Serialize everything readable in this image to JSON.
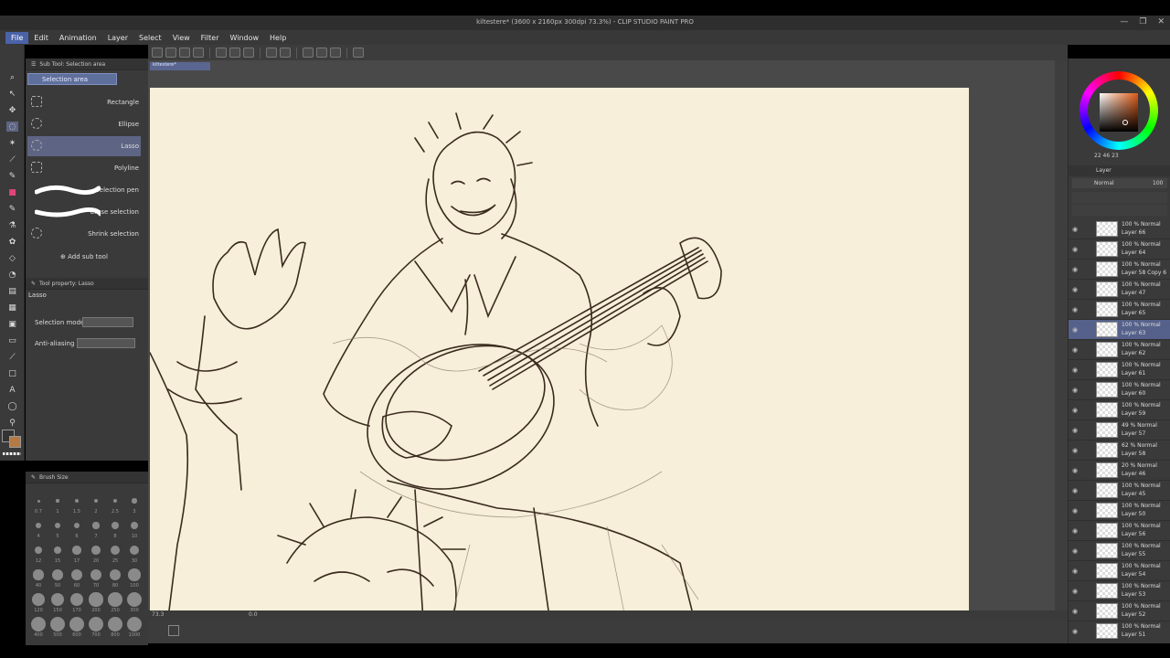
{
  "window": {
    "title": "kiltestere* (3600 x 2160px 300dpi 73.3%) - CLIP STUDIO PAINT PRO",
    "controls": [
      "—",
      "❐",
      "✕"
    ]
  },
  "menu": [
    "File",
    "Edit",
    "Animation",
    "Layer",
    "Select",
    "View",
    "Filter",
    "Window",
    "Help"
  ],
  "subtool_panel": {
    "header": "Sub Tool: Selection area",
    "tab": "Selection area",
    "items": [
      "Rectangle",
      "Ellipse",
      "Lasso",
      "Polyline",
      "Selection pen",
      "Erase selection",
      "Shrink selection"
    ],
    "selected_index": 2,
    "add_label": "Add sub tool"
  },
  "tool_property": {
    "header": "Tool property: Lasso",
    "tool_name": "Lasso",
    "rows": [
      {
        "label": "Selection mode"
      },
      {
        "label": "Anti-aliasing"
      }
    ]
  },
  "brush_size": {
    "header": "Brush Size",
    "labels": [
      "0.7",
      "1",
      "1.5",
      "2",
      "2.5",
      "3",
      "4",
      "5",
      "6",
      "7",
      "8",
      "10",
      "12",
      "15",
      "17",
      "20",
      "25",
      "30",
      "40",
      "50",
      "60",
      "70",
      "80",
      "100",
      "120",
      "150",
      "170",
      "200",
      "250",
      "300",
      "400",
      "500",
      "600",
      "700",
      "800",
      "1000"
    ]
  },
  "canvas": {
    "doc_tab": "kiltestere*",
    "zoom": "73.3",
    "rotation": "0.0"
  },
  "colors": {
    "paper": "#f7efd9",
    "accent": "#4a63a8",
    "sketch": "#3a2a1e"
  },
  "color_wheel": {
    "values": "22  46  23"
  },
  "layer_panel": {
    "header": "Layer",
    "blend": "Normal",
    "opacity": "100",
    "layers": [
      {
        "mode": "100 % Normal",
        "name": "Layer 66"
      },
      {
        "mode": "100 % Normal",
        "name": "Layer 64"
      },
      {
        "mode": "100 % Normal",
        "name": "Layer 58 Copy 6"
      },
      {
        "mode": "100 % Normal",
        "name": "Layer 47"
      },
      {
        "mode": "100 % Normal",
        "name": "Layer 65"
      },
      {
        "mode": "100 % Normal",
        "name": "Layer 63",
        "selected": true
      },
      {
        "mode": "100 % Normal",
        "name": "Layer 62"
      },
      {
        "mode": "100 % Normal",
        "name": "Layer 61"
      },
      {
        "mode": "100 % Normal",
        "name": "Layer 60"
      },
      {
        "mode": "100 % Normal",
        "name": "Layer 59"
      },
      {
        "mode": "49 % Normal",
        "name": "Layer 57"
      },
      {
        "mode": "62 % Normal",
        "name": "Layer 58"
      },
      {
        "mode": "20 % Normal",
        "name": "Layer 46"
      },
      {
        "mode": "100 % Normal",
        "name": "Layer 45"
      },
      {
        "mode": "100 % Normal",
        "name": "Layer 50"
      },
      {
        "mode": "100 % Normal",
        "name": "Layer 56"
      },
      {
        "mode": "100 % Normal",
        "name": "Layer 55"
      },
      {
        "mode": "100 % Normal",
        "name": "Layer 54"
      },
      {
        "mode": "100 % Normal",
        "name": "Layer 53"
      },
      {
        "mode": "100 % Normal",
        "name": "Layer 52"
      },
      {
        "mode": "100 % Normal",
        "name": "Layer 51"
      }
    ]
  },
  "icons": {
    "eye": "◉",
    "plus": "⊕"
  }
}
